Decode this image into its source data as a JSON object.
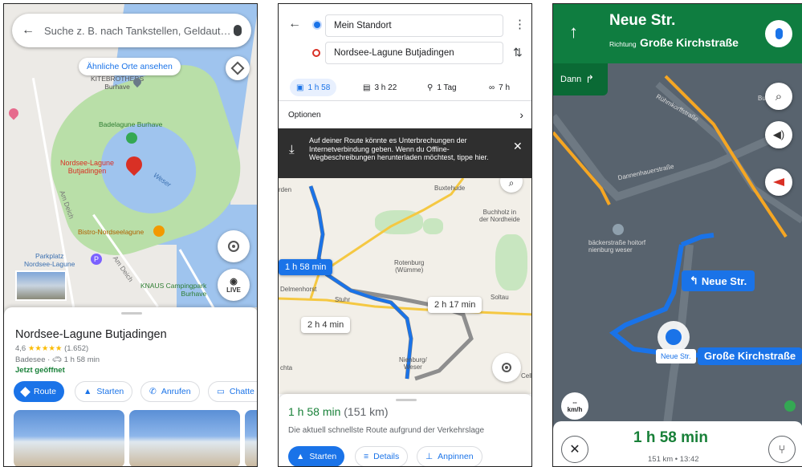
{
  "panel1": {
    "search_placeholder": "Suche z. B. nach Tankstellen, Geldaut…",
    "similar_chip": "Ähnliche Orte ansehen",
    "map_labels": {
      "kitebrothers": "KITEBROTHERS\nBurhave",
      "badelagune": "Badelagune Burhave",
      "selected": "Nordsee-Lagune\nButjadingen",
      "weser": "Weser",
      "bistro": "Bistro-Nordseelagune",
      "parkplatz": "Parkplatz\nNordsee-Lagune",
      "knaus": "KNAUS Campingpark\nBurhave",
      "street1": "Am Deich",
      "street2": "Am Deich"
    },
    "live_label": "LIVE",
    "place": {
      "title": "Nordsee-Lagune Butjadingen",
      "rating": "4,6",
      "stars": "★★★★★",
      "reviews": "(1.652)",
      "category": "Badesee",
      "drive_time": "1 h 58 min",
      "status": "Jetzt geöffnet"
    },
    "actions": [
      "Route",
      "Starten",
      "Anrufen",
      "Chatte"
    ]
  },
  "panel2": {
    "origin": "Mein Standort",
    "destination": "Nordsee-Lagune Butjadingen",
    "modes": [
      {
        "icon": "car-icon",
        "label": "1 h 58"
      },
      {
        "icon": "train-icon",
        "label": "3 h 22"
      },
      {
        "icon": "walk-icon",
        "label": "1 Tag"
      },
      {
        "icon": "bike-icon",
        "label": "7 h"
      }
    ],
    "options_label": "Optionen",
    "offline_banner": "Auf deiner Route könnte es Unterbrechungen der Internetverbindung geben. Wenn du Offline-Wegbeschreibungen herunterladen möchtest, tippe hier.",
    "route_tags": [
      "1 h 58 min",
      "2 h 17 min",
      "2 h 4 min"
    ],
    "map_labels": {
      "buxtehude": "Buxtehude",
      "buchholz": "Buchholz in\nder Nordheide",
      "rotenburg": "Rotenburg\n(Wümme)",
      "delmenhorst": "Delmenhorst",
      "soltau": "Soltau",
      "nienburg": "Nienburg/\nWeser",
      "stuhr": "Stuhr",
      "vechta": "chta",
      "bremen": "rden",
      "celle": "Celle"
    },
    "summary": {
      "time": "1 h 58 min",
      "distance": "(151 km)",
      "note": "Die aktuell schnellste Route aufgrund der Verkehrslage"
    },
    "buttons": [
      "Starten",
      "Details",
      "Anpinnen"
    ]
  },
  "panel3": {
    "street": "Neue Str.",
    "direction_prefix": "Richtung",
    "direction": "Große Kirchstraße",
    "then_label": "Dann",
    "map_labels": {
      "buergerpark": "Buerg…ade",
      "ruehmkorff": "Rühmkorffstraße",
      "dannenhauer": "Dannenhauerstraße",
      "poi": "bäckerstraße hoitorf\nnienburg weser"
    },
    "sign_turn": "Neue Str.",
    "sign_small": "Neue Str.",
    "sign_big": "Große Kirchstraße",
    "speed": "--",
    "speed_unit": "km/h",
    "eta_time": "1 h 58 min",
    "eta_detail": "151 km • 13:42"
  }
}
